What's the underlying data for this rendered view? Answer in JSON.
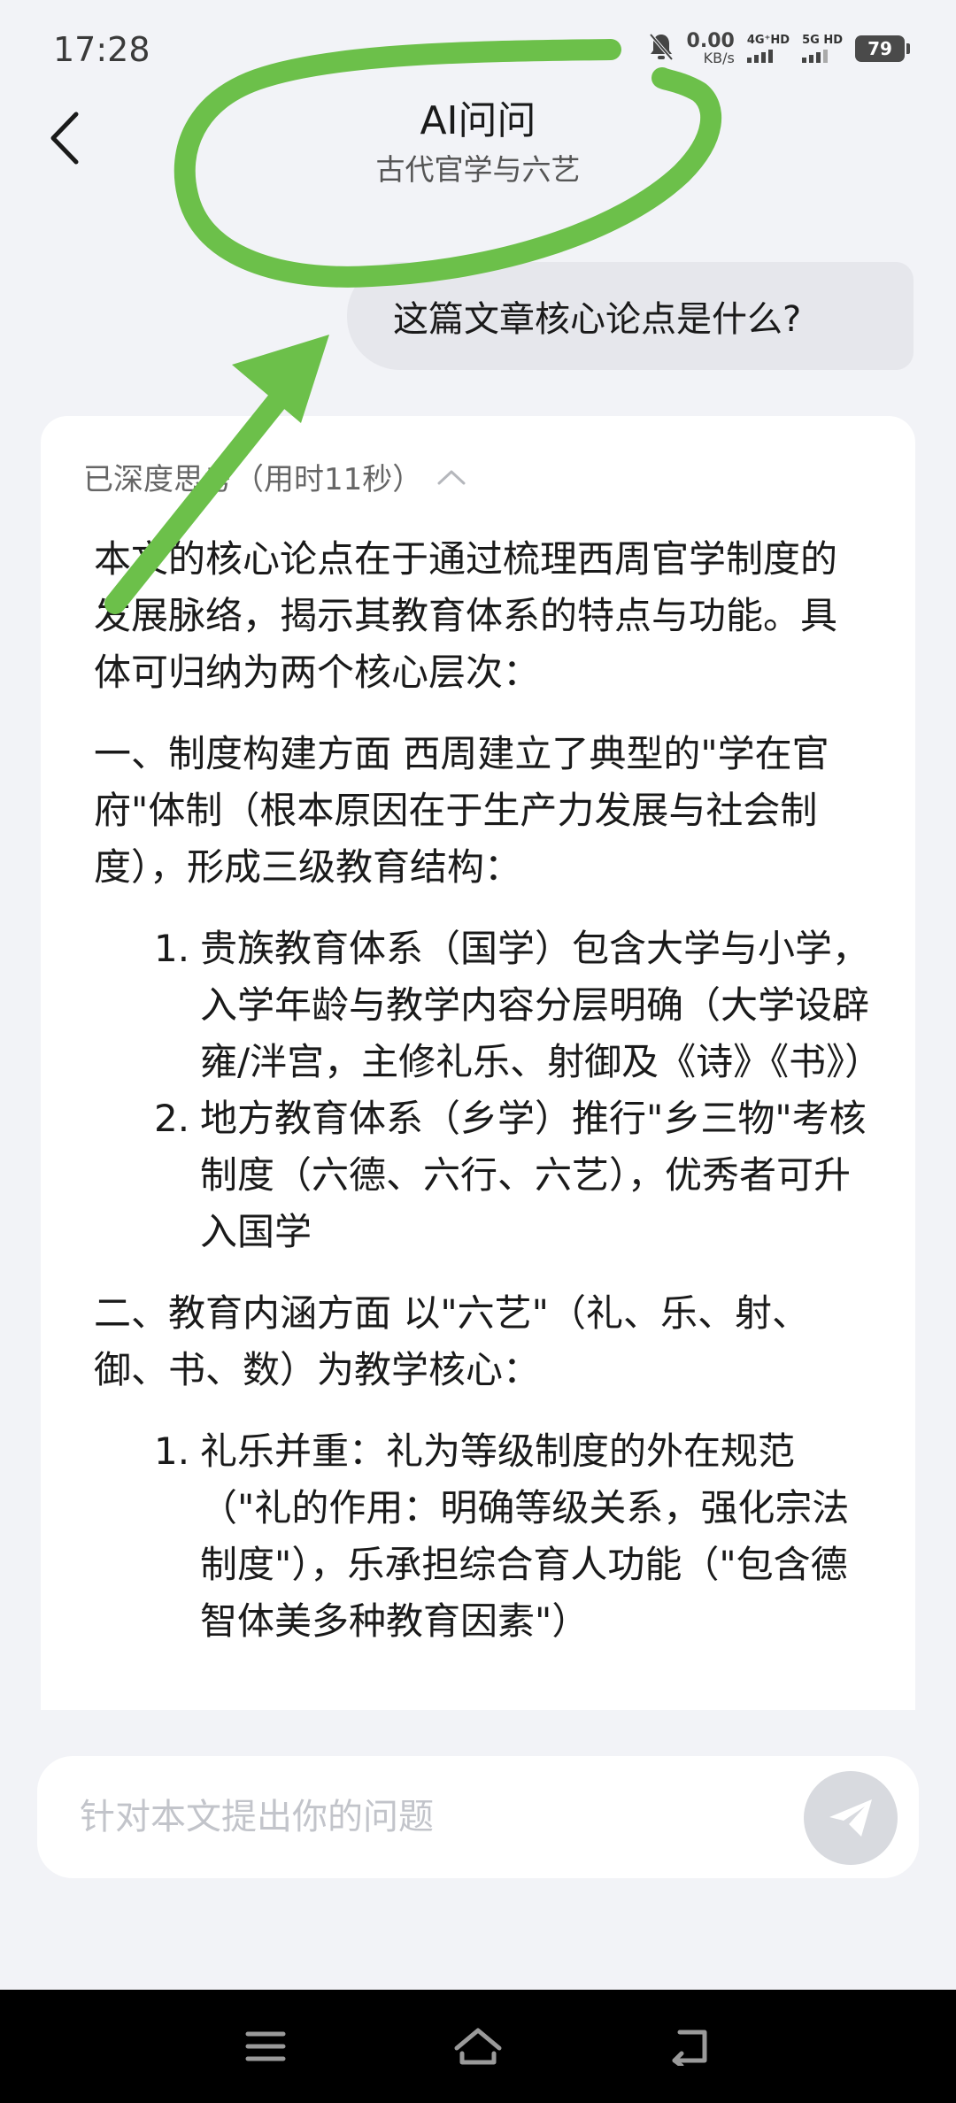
{
  "status_bar": {
    "time": "17:28",
    "net_speed_value": "0.00",
    "net_speed_unit": "KB/s",
    "signal1_label": "4G⁺HD",
    "signal2_label": "5G HD",
    "battery": "79"
  },
  "header": {
    "title": "AI问问",
    "subtitle": "古代官学与六艺"
  },
  "user_message": "这篇文章核心论点是什么?",
  "answer": {
    "thinking_label": "已深度思考（用时11秒）",
    "intro": "本文的核心论点在于通过梳理西周官学制度的发展脉络，揭示其教育体系的特点与功能。具体可归纳为两个核心层次：",
    "section1": "一、制度构建方面 西周建立了典型的\"学在官府\"体制（根本原因在于生产力发展与社会制度），形成三级教育结构：",
    "section1_items": [
      {
        "num": "1.",
        "text": "贵族教育体系（国学）包含大学与小学，入学年龄与教学内容分层明确（大学设辟雍/泮宫，主修礼乐、射御及《诗》《书》）"
      },
      {
        "num": "2.",
        "text": "地方教育体系（乡学）推行\"乡三物\"考核制度（六德、六行、六艺），优秀者可升入国学"
      }
    ],
    "section2": "二、教育内涵方面 以\"六艺\"（礼、乐、射、御、书、数）为教学核心：",
    "section2_items": [
      {
        "num": "1.",
        "text": "礼乐并重：礼为等级制度的外在规范（\"礼的作用：明确等级关系，强化宗法制度\"），乐承担综合育人功能（\"包含德智体美多种教育因素\"）"
      }
    ]
  },
  "input": {
    "placeholder": "针对本文提出你的问题"
  },
  "colors": {
    "background": "#f2f3f7",
    "annotation_green": "#6cc04a",
    "send_button": "#d8dadf"
  },
  "icons": {
    "back": "chevron-left-icon",
    "mute": "bell-off-icon",
    "thinking_toggle": "chevron-up-icon",
    "send": "paper-plane-icon",
    "nav_menu": "menu-icon",
    "nav_home": "home-icon",
    "nav_back": "return-icon"
  }
}
